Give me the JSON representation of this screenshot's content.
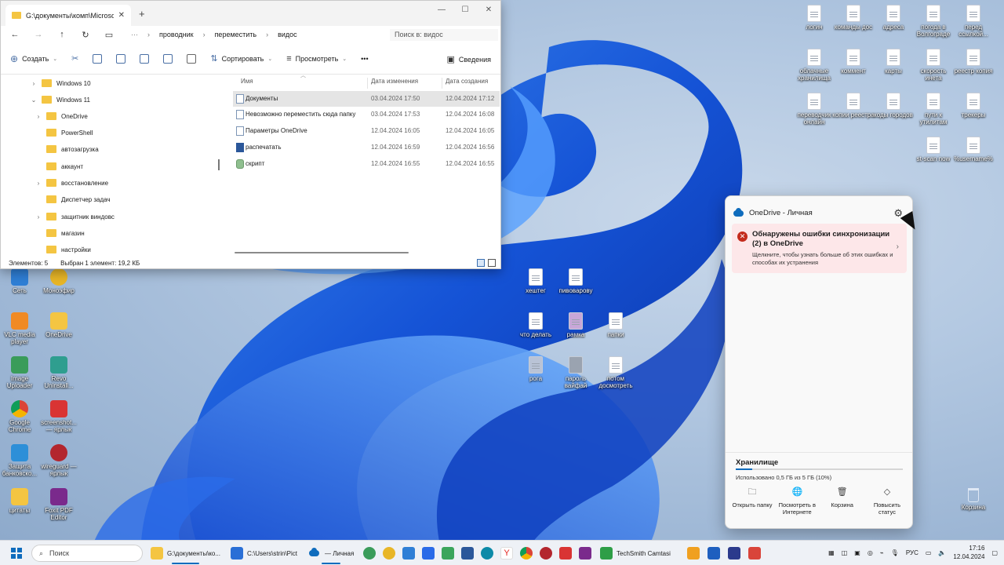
{
  "explorer": {
    "tab_title": "G:\\документы\\комп\\Microsof",
    "breadcrumbs": [
      "проводник",
      "переместить",
      "видос"
    ],
    "search_placeholder": "Поиск в: видос",
    "commands": {
      "new": "Создать",
      "sort": "Сортировать",
      "view": "Просмотреть",
      "more": "•••",
      "details": "Сведения"
    },
    "tree": [
      {
        "label": "Windows 10",
        "expander": "›"
      },
      {
        "label": "Windows 11",
        "expander": "⌄"
      },
      {
        "label": "OneDrive",
        "expander": "›"
      },
      {
        "label": "PowerShell",
        "expander": ""
      },
      {
        "label": "автозагрузка",
        "expander": ""
      },
      {
        "label": "аккаунт",
        "expander": ""
      },
      {
        "label": "восстановление",
        "expander": "›"
      },
      {
        "label": "Диспетчер задач",
        "expander": ""
      },
      {
        "label": "защитник виндовс",
        "expander": "›"
      },
      {
        "label": "магазин",
        "expander": ""
      },
      {
        "label": "настройки",
        "expander": ""
      }
    ],
    "columns": {
      "name": "Имя",
      "modified": "Дата изменения",
      "created": "Дата создания"
    },
    "files": [
      {
        "name": "Документы",
        "modified": "03.04.2024 17:50",
        "created": "12.04.2024 17:12",
        "selected": true,
        "icon": "text-file-icon"
      },
      {
        "name": "Невозможно переместить сюда папку",
        "modified": "03.04.2024 17:53",
        "created": "12.04.2024 16:08",
        "selected": false,
        "icon": "text-file-icon"
      },
      {
        "name": "Параметры OneDrive",
        "modified": "12.04.2024 16:05",
        "created": "12.04.2024 16:05",
        "selected": false,
        "icon": "text-file-icon"
      },
      {
        "name": "распечатать",
        "modified": "12.04.2024 16:59",
        "created": "12.04.2024 16:56",
        "selected": false,
        "icon": "word-file-icon"
      },
      {
        "name": "скрипт",
        "modified": "12.04.2024 16:55",
        "created": "12.04.2024 16:55",
        "selected": false,
        "icon": "script-file-icon"
      }
    ],
    "status": {
      "count": "Элементов: 5",
      "selection": "Выбран 1 элемент: 19,2 КБ"
    }
  },
  "onedrive": {
    "title": "OneDrive - Личная",
    "error_title": "Обнаружены ошибки синхронизации (2) в OneDrive",
    "error_desc": "Щелкните, чтобы узнать больше об этих ошибках и способах их устранения",
    "storage_title": "Хранилище",
    "storage_text": "Использовано 0,5 ГБ из 5 ГБ (10%)",
    "storage_fraction": 0.1,
    "actions": [
      {
        "label": "Открыть папку",
        "icon": "folder-icon"
      },
      {
        "label": "Посмотреть в Интернете",
        "icon": "globe-icon"
      },
      {
        "label": "Корзина",
        "icon": "trash-icon"
      },
      {
        "label": "Повысить статус",
        "icon": "diamond-icon"
      }
    ]
  },
  "desktop_icons": {
    "right_grid": [
      "логин",
      "команды дос",
      "адреса",
      "погода в Волгограде",
      "перед ссылкой...",
      "облачные хранилища",
      "коммент",
      "карты",
      "скорость инета",
      "реестр копия",
      "переводчик онлайн",
      "копии реестра",
      "коды городов",
      "пути к утилитам",
      "трекеры",
      "st-scan now",
      "%username%"
    ],
    "left_column": [
      "Сеть",
      "Моноэфир",
      "VLC media player",
      "OneDrive",
      "Image Uploader",
      "Revo Uninstall...",
      "Google Chrome",
      "screenshot... — ярлык",
      "Защита банковско...",
      "wireguard — ярлык",
      "цитаты",
      "Foxit PDF Editor"
    ],
    "middle": [
      "хештег",
      "пивоварову",
      "что делать",
      "рамка",
      "папки",
      "рога",
      "пароль вайфай",
      "потом досмотреть"
    ],
    "recycle_bin": "Корзина"
  },
  "taskbar": {
    "search": "Поиск",
    "items": [
      "G:\\документы\\ко...",
      "C:\\Users\\strin\\Pict",
      "— Личная",
      "TechSmith Camtasi"
    ],
    "lang": "РУС",
    "time": "17:16",
    "date": "12.04.2024"
  },
  "colors": {
    "accent": "#0f6cbd",
    "error_bg": "#fde7e9",
    "error_icon": "#c42b1c"
  }
}
